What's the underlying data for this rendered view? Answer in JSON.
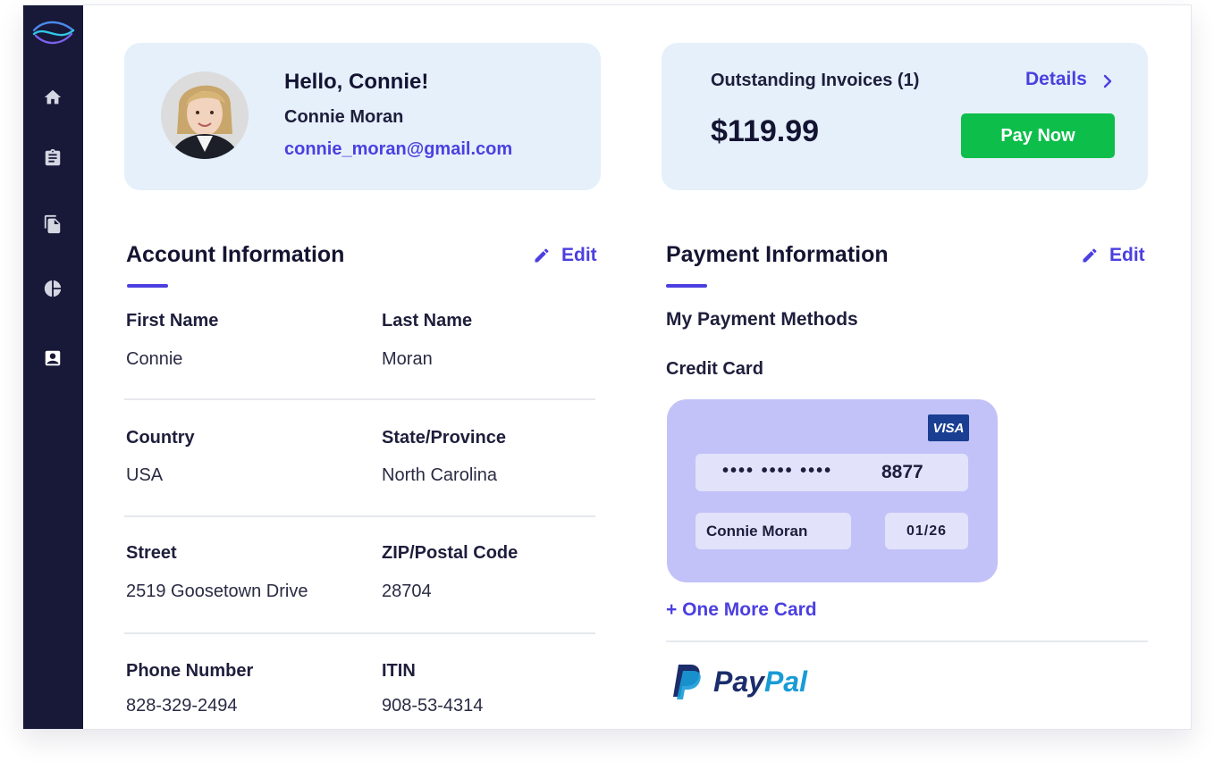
{
  "profile": {
    "greeting": "Hello, Connie!",
    "name": "Connie Moran",
    "email": "connie_moran@gmail.com"
  },
  "invoices": {
    "title": "Outstanding Invoices (1)",
    "details_label": "Details",
    "amount": "$119.99",
    "pay_label": "Pay Now"
  },
  "account": {
    "title": "Account Information",
    "edit_label": "Edit",
    "fields": [
      {
        "label": "First Name",
        "value": "Connie"
      },
      {
        "label": "Last Name",
        "value": "Moran"
      },
      {
        "label": "Country",
        "value": "USA"
      },
      {
        "label": "State/Province",
        "value": "North Carolina"
      },
      {
        "label": "Street",
        "value": "2519 Goosetown Drive"
      },
      {
        "label": "ZIP/Postal Code",
        "value": "28704"
      },
      {
        "label": "Phone Number",
        "value": "828-329-2494"
      },
      {
        "label": "ITIN",
        "value": "908-53-4314"
      }
    ]
  },
  "payment": {
    "title": "Payment Information",
    "edit_label": "Edit",
    "methods_title": "My Payment Methods",
    "credit_card_label": "Credit Card",
    "card": {
      "brand": "VISA",
      "masked": "•••• •••• ••••",
      "last4": "8877",
      "holder": "Connie Moran",
      "expiry": "01/26"
    },
    "add_card_label": "+ One More Card",
    "paypal": {
      "part1": "Pay",
      "part2": "Pal"
    }
  },
  "sidebar": {
    "icons": [
      "home-icon",
      "clipboard-icon",
      "documents-icon",
      "pie-chart-icon",
      "contact-card-icon"
    ]
  },
  "colors": {
    "sidebar": "#181838",
    "accent": "#4b3fe0",
    "panel": "#e5f0fb",
    "pay_button": "#0ebe4a",
    "card": "#c2c2f8",
    "visa": "#1a3e92"
  }
}
